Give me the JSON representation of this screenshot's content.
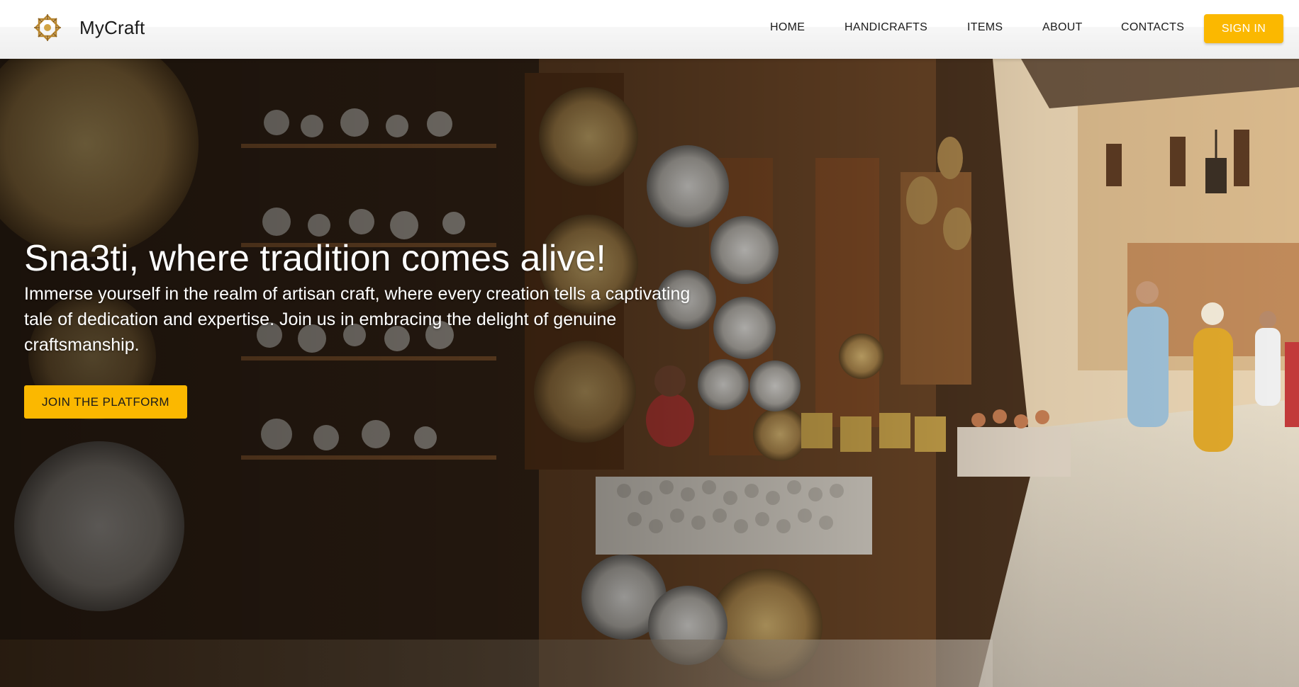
{
  "brand": {
    "name": "MyCraft",
    "logo_icon": "geometric-star-ornament-icon"
  },
  "nav": {
    "items": [
      {
        "label": "HOME"
      },
      {
        "label": "HANDICRAFTS"
      },
      {
        "label": "ITEMS"
      },
      {
        "label": "ABOUT"
      },
      {
        "label": "CONTACTS"
      }
    ],
    "signin_label": "SIGN IN"
  },
  "hero": {
    "title": "Sna3ti, where tradition comes alive!",
    "text": "Immerse yourself in the realm of artisan craft, where every creation tells a captivating tale of dedication and expertise. Join us in embracing the delight of genuine craftsmanship.",
    "cta_label": "JOIN THE PLATFORM"
  },
  "colors": {
    "accent": "#fbb800",
    "header_bg": "#ffffff",
    "text_dark": "#1b1b1b",
    "hero_text": "#ffffff"
  }
}
